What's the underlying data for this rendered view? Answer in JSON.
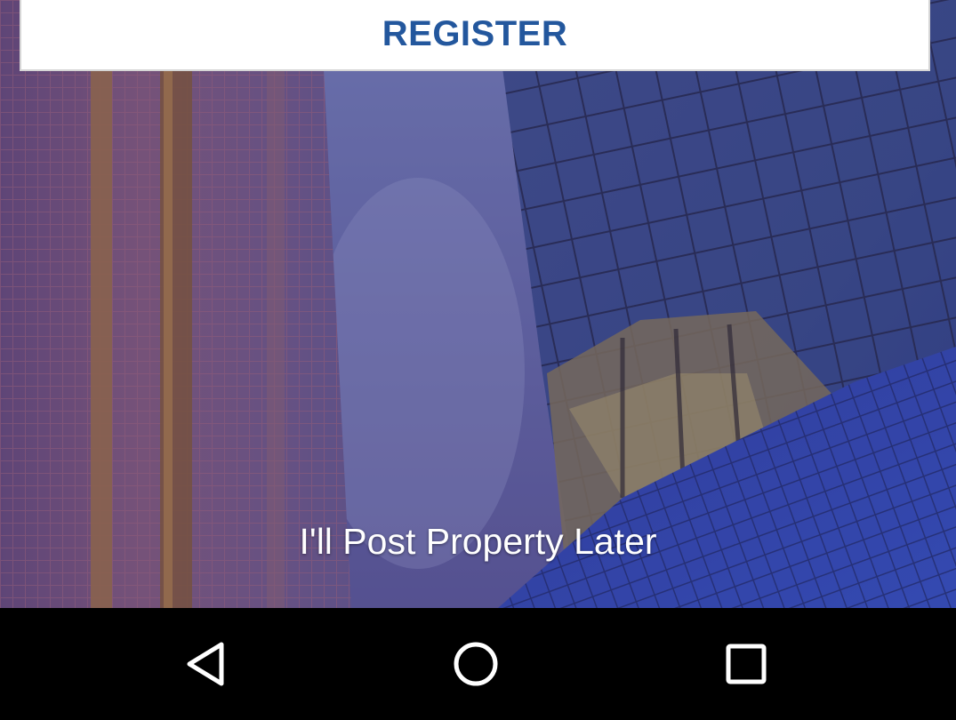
{
  "register": {
    "label": "REGISTER",
    "color": "#23579d"
  },
  "skip_link": {
    "label": "I'll Post Property Later"
  },
  "nav_bar": {
    "back_icon": "triangle-back-icon",
    "home_icon": "circle-home-icon",
    "recent_icon": "square-recents-icon"
  },
  "colors": {
    "overlay": "#3f3a78",
    "nav_background": "#000000",
    "nav_icon": "#ffffff"
  }
}
